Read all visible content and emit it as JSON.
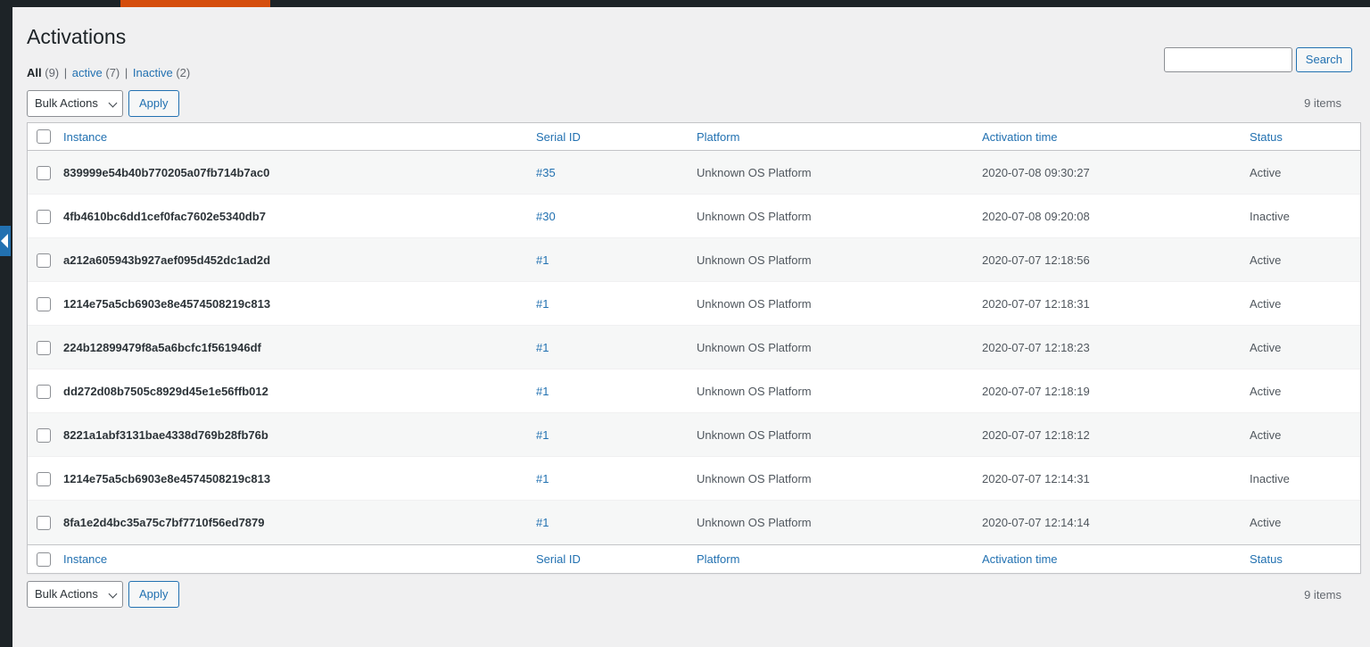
{
  "adminbar": {
    "highlight_color": "#d54e0d",
    "bar_color": "#1d2327"
  },
  "page": {
    "title": "Activations"
  },
  "views": {
    "items": [
      {
        "label": "All",
        "count": "(9)",
        "current": true
      },
      {
        "label": "active",
        "count": "(7)",
        "current": false
      },
      {
        "label": "Inactive",
        "count": "(2)",
        "current": false
      }
    ],
    "separator": "|"
  },
  "search": {
    "value": "",
    "placeholder": "",
    "button_label": "Search"
  },
  "tablenav_top": {
    "bulk_selected": "Bulk Actions",
    "bulk_options": [
      "Bulk Actions"
    ],
    "apply_label": "Apply",
    "displaying_num": "9 items"
  },
  "tablenav_bottom": {
    "bulk_selected": "Bulk Actions",
    "bulk_options": [
      "Bulk Actions"
    ],
    "apply_label": "Apply",
    "displaying_num": "9 items"
  },
  "table": {
    "columns": {
      "instance": "Instance",
      "serial": "Serial ID",
      "platform": "Platform",
      "time": "Activation time",
      "status": "Status"
    },
    "rows": [
      {
        "instance": "839999e54b40b770205a07fb714b7ac0",
        "serial": "#35",
        "platform": "Unknown OS Platform",
        "time": "2020-07-08 09:30:27",
        "status": "Active"
      },
      {
        "instance": "4fb4610bc6dd1cef0fac7602e5340db7",
        "serial": "#30",
        "platform": "Unknown OS Platform",
        "time": "2020-07-08 09:20:08",
        "status": "Inactive"
      },
      {
        "instance": "a212a605943b927aef095d452dc1ad2d",
        "serial": "#1",
        "platform": "Unknown OS Platform",
        "time": "2020-07-07 12:18:56",
        "status": "Active"
      },
      {
        "instance": "1214e75a5cb6903e8e4574508219c813",
        "serial": "#1",
        "platform": "Unknown OS Platform",
        "time": "2020-07-07 12:18:31",
        "status": "Active"
      },
      {
        "instance": "224b12899479f8a5a6bcfc1f561946df",
        "serial": "#1",
        "platform": "Unknown OS Platform",
        "time": "2020-07-07 12:18:23",
        "status": "Active"
      },
      {
        "instance": "dd272d08b7505c8929d45e1e56ffb012",
        "serial": "#1",
        "platform": "Unknown OS Platform",
        "time": "2020-07-07 12:18:19",
        "status": "Active"
      },
      {
        "instance": "8221a1abf3131bae4338d769b28fb76b",
        "serial": "#1",
        "platform": "Unknown OS Platform",
        "time": "2020-07-07 12:18:12",
        "status": "Active"
      },
      {
        "instance": "1214e75a5cb6903e8e4574508219c813",
        "serial": "#1",
        "platform": "Unknown OS Platform",
        "time": "2020-07-07 12:14:31",
        "status": "Inactive"
      },
      {
        "instance": "8fa1e2d4bc35a75c7bf7710f56ed7879",
        "serial": "#1",
        "platform": "Unknown OS Platform",
        "time": "2020-07-07 12:14:14",
        "status": "Active"
      }
    ]
  },
  "colors": {
    "link": "#2271b1",
    "text": "#2c3338",
    "muted": "#646970",
    "background": "#f0f0f1",
    "sidebar": "#1d2327",
    "row_alt": "#f6f7f7"
  }
}
